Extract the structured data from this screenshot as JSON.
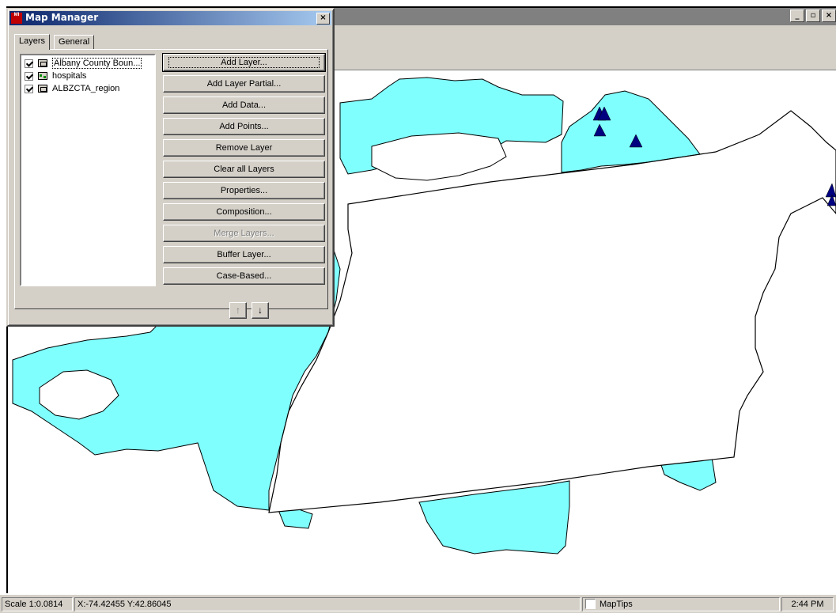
{
  "map_manager": {
    "title": "Map Manager",
    "app_icon_text": "MI",
    "close_glyph": "×",
    "tabs": [
      {
        "label": "Layers",
        "active": true
      },
      {
        "label": "General",
        "active": false
      }
    ],
    "layers": [
      {
        "label": "Albany County Boun...",
        "checked": true,
        "icon": "region-layer-icon",
        "selected": true
      },
      {
        "label": "hospitals",
        "checked": true,
        "icon": "points-layer-icon"
      },
      {
        "label": "ALBZCTA_region",
        "checked": true,
        "icon": "region-layer-icon"
      }
    ],
    "buttons": {
      "add_layer": "Add Layer...",
      "add_layer_partial": "Add Layer Partial...",
      "add_data": "Add Data...",
      "add_points": "Add Points...",
      "remove_layer": "Remove Layer",
      "clear_all_layers": "Clear all Layers",
      "properties": "Properties...",
      "composition": "Composition...",
      "merge_layers": "Merge Layers...",
      "buffer_layer": "Buffer Layer...",
      "case_based": "Case-Based..."
    },
    "move_up_glyph": "↑",
    "move_down_glyph": "↓"
  },
  "main_window": {
    "controls": {
      "minimize": "_",
      "restore": "▫",
      "close": "×"
    }
  },
  "status_bar": {
    "scale": "Scale 1:0.0814",
    "coords": "X:-74.42455 Y:42.86045",
    "maptips_label": "MapTips",
    "maptips_checked": false,
    "time": "2:44 PM"
  },
  "colors": {
    "region_fill": "#80ffff",
    "county_fill": "#ffffff",
    "hospital_marker": "#000080",
    "dialog_face": "#d4d0c8",
    "title_gradient_start": "#0a246a"
  }
}
